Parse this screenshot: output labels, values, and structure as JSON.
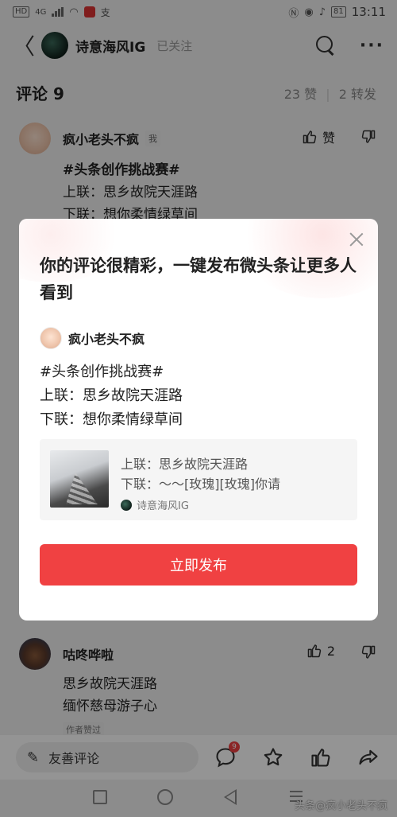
{
  "status_bar": {
    "left_items": [
      "HD",
      "4G"
    ],
    "wechat_char": "支",
    "battery": "81",
    "time": "13:11"
  },
  "header": {
    "back_glyph": "〈",
    "account_name": "诗意海风IG",
    "follow_status": "已关注"
  },
  "comments_header": {
    "title": "评论 9",
    "likes": "23 赞",
    "separator": "|",
    "shares": "2 转发"
  },
  "comments": [
    {
      "name": "疯小老头不疯",
      "me_tag": "我",
      "like_label": "赞",
      "lines": [
        "#头条创作挑战赛#",
        "上联：思乡故院天涯路",
        "下联：想你柔情绿草间"
      ]
    },
    {
      "name": "咕咚哗啦",
      "like_count": "2",
      "lines": [
        "思乡故院天涯路",
        "缅怀慈母游子心"
      ],
      "author_tag": "作者赞过"
    }
  ],
  "modal": {
    "title": "你的评论很精彩，一键发布微头条让更多人看到",
    "author": "疯小老头不疯",
    "body": [
      "#头条创作挑战赛#",
      "上联：思乡故院天涯路",
      "下联：想你柔情绿草间"
    ],
    "card": {
      "line1": "上联：思乡故院天涯路",
      "line2": "下联：～～[玫瑰][玫瑰]你请",
      "source": "诗意海风IG"
    },
    "button": "立即发布"
  },
  "bottom_bar": {
    "comment_placeholder": "友善评论",
    "comment_badge": "9"
  },
  "watermark": "头条@疯小老头不疯",
  "colors": {
    "accent": "#f04142",
    "overlay": "rgba(0,0,0,0.42)"
  },
  "icons": [
    "back-icon",
    "search-icon",
    "more-icon",
    "thumbs-up-icon",
    "thumbs-down-icon",
    "close-icon",
    "pen-icon",
    "comment-bubble-icon",
    "star-icon",
    "share-icon"
  ]
}
